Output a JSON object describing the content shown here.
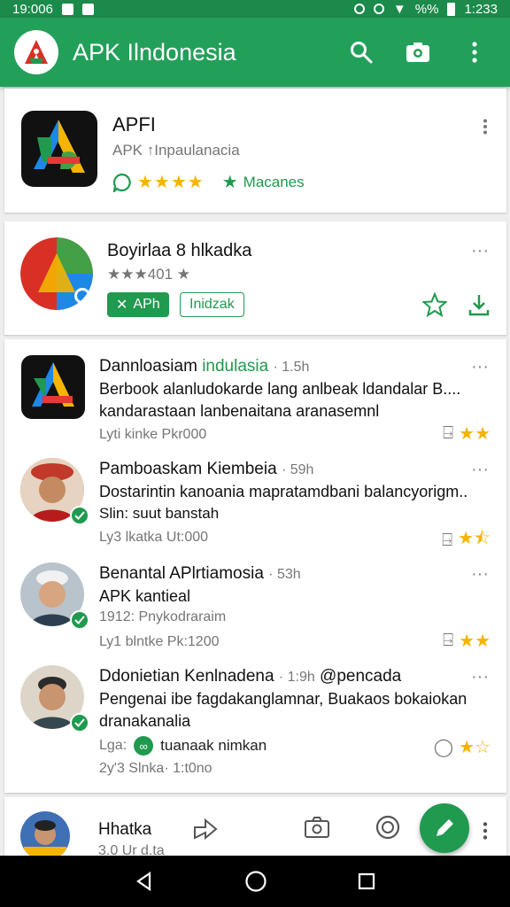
{
  "status_bar": {
    "time_left": "19:006",
    "time_right": "1:233",
    "battery": "%%"
  },
  "app_bar": {
    "title": "APK Ilndonesia"
  },
  "featured_app": {
    "name": "APFI",
    "developer": "APK ↑Inpaulanacia",
    "stars": "★★★★",
    "badge_label": "Macanes"
  },
  "second_app": {
    "name": "Boyirlaa 8 hlkadka",
    "rating_text": "★★★401 ★",
    "chip_primary": "APh",
    "chip_secondary": "Inidzak"
  },
  "feed": [
    {
      "author": "Dannloasiam",
      "tag": "indulasia",
      "time": "· 1.5h",
      "line1": "Berbook alanludokarde lang anlbeak ldandalar B....",
      "line2": "kandarastaan lanbenaitana aranasemnl",
      "meta": "Lyti kinke Pkr000",
      "stars": "★★"
    },
    {
      "author": "Pamboaskam Kiembeia",
      "time": "· 59h",
      "line1": "Dostarintin kanoania mapratamdbani balancyorigm..",
      "line2": "Slin: suut banstah",
      "meta": "Ly3 lkatka Ut:000",
      "stars": "★⯪"
    },
    {
      "author": "Benantal APlrtiamosia",
      "time": "· 53h",
      "line1": "APK kantieal",
      "line2": "1912: Pnykodraraim",
      "meta": "Ly1 blntke Pk:1200",
      "stars": "★★"
    },
    {
      "author": "Ddonietian Kenlnadena",
      "time": "· 1:9h",
      "handle": "@pencada",
      "line1": "Pengenai ibe fagdakanglamnar, Buakaos bokaiokan",
      "line2": "dranakanalia",
      "link_text": "tuanaak nimkan",
      "meta_prefix": "Lga:",
      "meta": "2y'3 Slnka· 1:t0no",
      "stars": "★☆"
    }
  ],
  "partial_item": {
    "author": "Hhatka",
    "meta": "3.0 Ur d.ta"
  },
  "colors": {
    "primary": "#22a05a",
    "accent": "#1f9a4e",
    "star": "#f4b400"
  },
  "icons": [
    "search-icon",
    "camera-icon",
    "more-vert-icon",
    "star-outline-icon",
    "download-icon",
    "comment-icon",
    "share-icon",
    "edit-icon",
    "back-icon",
    "home-icon",
    "recents-icon"
  ]
}
